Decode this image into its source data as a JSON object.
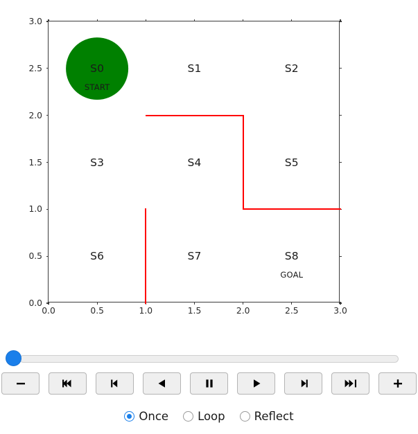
{
  "chart_data": {
    "type": "line",
    "title": "",
    "xlabel": "",
    "ylabel": "",
    "xlim": [
      0.0,
      3.0
    ],
    "ylim": [
      0.0,
      3.0
    ],
    "grid": false,
    "legend": "none",
    "x_ticks": [
      "0.0",
      "0.5",
      "1.0",
      "1.5",
      "2.0",
      "2.5",
      "3.0"
    ],
    "x_tick_values": [
      0.0,
      0.5,
      1.0,
      1.5,
      2.0,
      2.5,
      3.0
    ],
    "y_ticks": [
      "0.0",
      "0.5",
      "1.0",
      "1.5",
      "2.0",
      "2.5",
      "3.0"
    ],
    "y_tick_values": [
      0.0,
      0.5,
      1.0,
      1.5,
      2.0,
      2.5,
      3.0
    ],
    "cells": [
      {
        "id": "S0",
        "label": "S0",
        "sublabel": "START",
        "x": 0.5,
        "y": 2.5
      },
      {
        "id": "S1",
        "label": "S1",
        "sublabel": "",
        "x": 1.5,
        "y": 2.5
      },
      {
        "id": "S2",
        "label": "S2",
        "sublabel": "",
        "x": 2.5,
        "y": 2.5
      },
      {
        "id": "S3",
        "label": "S3",
        "sublabel": "",
        "x": 0.5,
        "y": 1.5
      },
      {
        "id": "S4",
        "label": "S4",
        "sublabel": "",
        "x": 1.5,
        "y": 1.5
      },
      {
        "id": "S5",
        "label": "S5",
        "sublabel": "",
        "x": 2.5,
        "y": 1.5
      },
      {
        "id": "S6",
        "label": "S6",
        "sublabel": "",
        "x": 0.5,
        "y": 0.5
      },
      {
        "id": "S7",
        "label": "S7",
        "sublabel": "",
        "x": 1.5,
        "y": 0.5
      },
      {
        "id": "S8",
        "label": "S8",
        "sublabel": "GOAL",
        "x": 2.5,
        "y": 0.5
      }
    ],
    "agent": {
      "label": "S0",
      "sublabel": "START",
      "x": 0.5,
      "y": 2.5,
      "radius_data": 0.32,
      "color": "#008000"
    },
    "wall_color": "#ff0000",
    "walls": [
      {
        "x0": 1.0,
        "y0": 2.0,
        "x1": 2.0,
        "y1": 2.0
      },
      {
        "x0": 2.0,
        "y0": 2.0,
        "x1": 2.0,
        "y1": 1.0
      },
      {
        "x0": 2.0,
        "y0": 1.0,
        "x1": 3.0,
        "y1": 1.0
      },
      {
        "x0": 1.0,
        "y0": 1.0,
        "x1": 1.0,
        "y1": 0.0
      }
    ]
  },
  "controls": {
    "slider": {
      "value": 0,
      "min": 0,
      "max": 100
    },
    "buttons": [
      {
        "name": "decrease-speed-button",
        "icon": "minus-icon",
        "label": "−"
      },
      {
        "name": "rewind-to-start-button",
        "icon": "skip-to-start-icon",
        "label": "⏮"
      },
      {
        "name": "step-back-button",
        "icon": "step-backward-icon",
        "label": "⏪"
      },
      {
        "name": "play-backward-button",
        "icon": "play-backward-icon",
        "label": "◀"
      },
      {
        "name": "pause-button",
        "icon": "pause-icon",
        "label": "⏸"
      },
      {
        "name": "play-forward-button",
        "icon": "play-forward-icon",
        "label": "▶"
      },
      {
        "name": "step-forward-button",
        "icon": "step-forward-icon",
        "label": "⏩"
      },
      {
        "name": "skip-to-end-button",
        "icon": "skip-to-end-icon",
        "label": "⏭"
      },
      {
        "name": "increase-speed-button",
        "icon": "plus-icon",
        "label": "+"
      }
    ],
    "loop_modes": [
      {
        "value": "once",
        "label": "Once",
        "selected": true
      },
      {
        "value": "loop",
        "label": "Loop",
        "selected": false
      },
      {
        "value": "reflect",
        "label": "Reflect",
        "selected": false
      }
    ]
  },
  "colors": {
    "agent_green": "#008000",
    "wall_red": "#ff0000",
    "accent_blue": "#1a7fea",
    "axis": "#3b3b3b"
  }
}
